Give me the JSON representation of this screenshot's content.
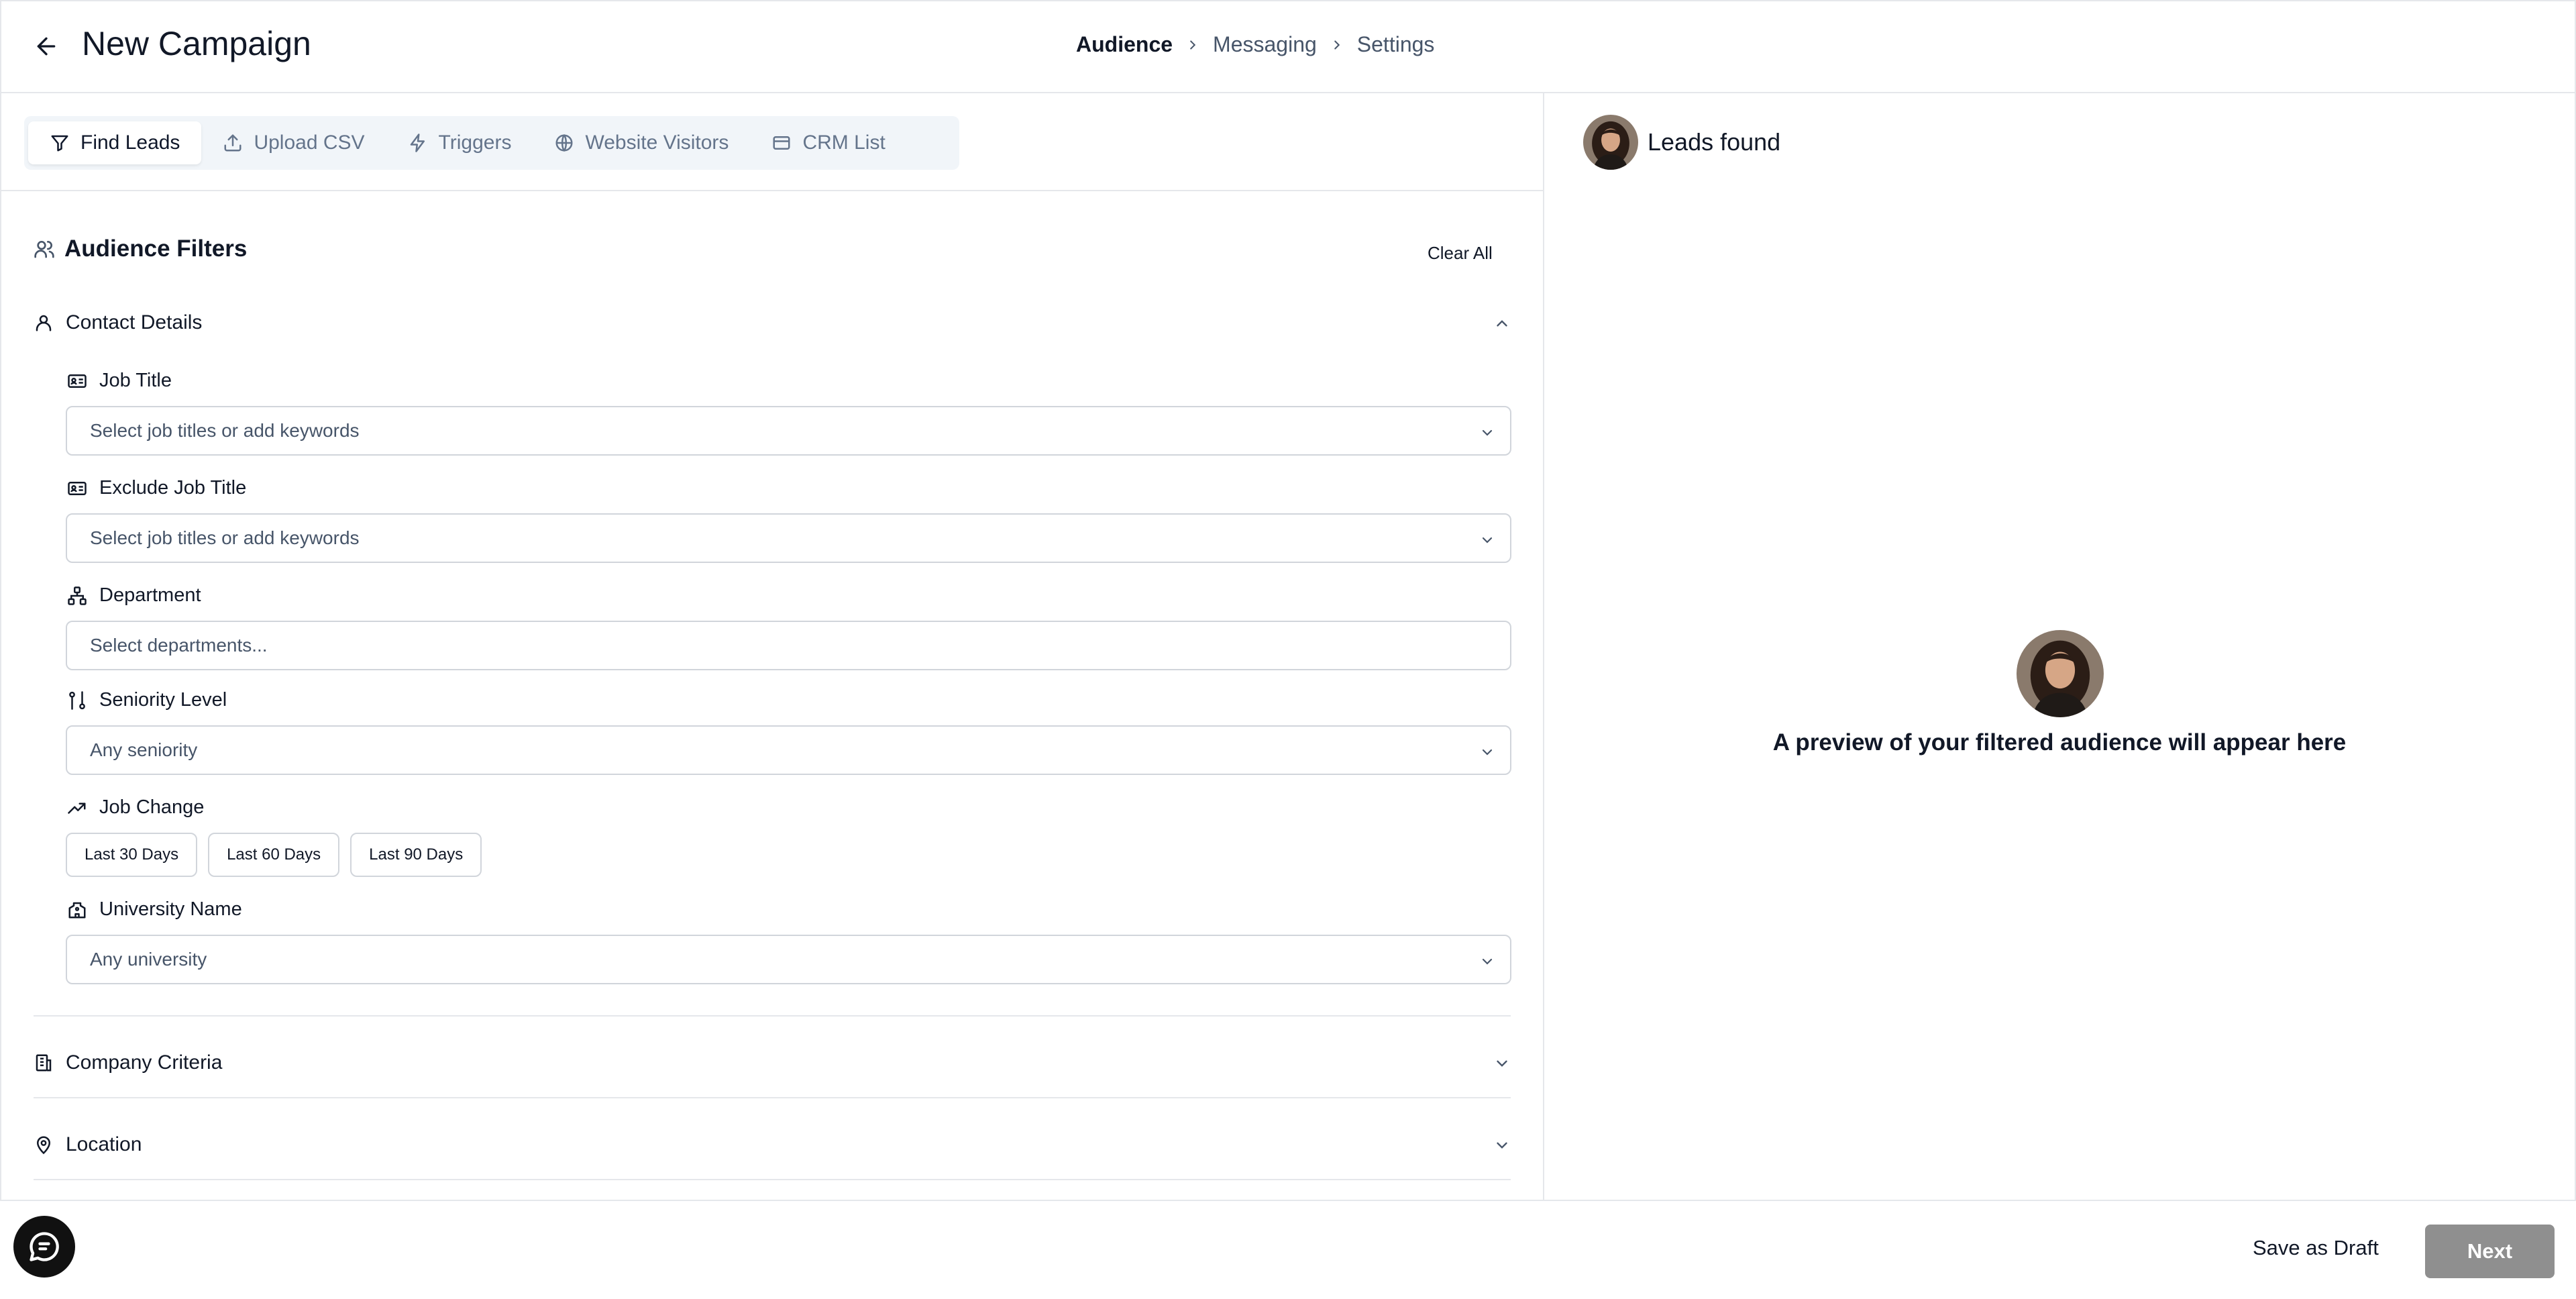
{
  "header": {
    "title": "New Campaign",
    "steps": [
      "Audience",
      "Messaging",
      "Settings"
    ],
    "active_step": "Audience"
  },
  "tabs": [
    {
      "label": "Find Leads",
      "icon": "filter-icon",
      "active": true
    },
    {
      "label": "Upload CSV",
      "icon": "upload-icon",
      "active": false
    },
    {
      "label": "Triggers",
      "icon": "lightning-icon",
      "active": false
    },
    {
      "label": "Website Visitors",
      "icon": "globe-icon",
      "active": false
    },
    {
      "label": "CRM List",
      "icon": "card-icon",
      "active": false
    }
  ],
  "filters": {
    "title": "Audience Filters",
    "clear_all": "Clear All",
    "contact_details": {
      "label": "Contact Details",
      "job_title": {
        "label": "Job Title",
        "placeholder": "Select job titles or add keywords"
      },
      "exclude_job_title": {
        "label": "Exclude Job Title",
        "placeholder": "Select job titles or add keywords"
      },
      "department": {
        "label": "Department",
        "placeholder": "Select departments..."
      },
      "seniority": {
        "label": "Seniority Level",
        "value": "Any seniority"
      },
      "job_change": {
        "label": "Job Change",
        "options": [
          "Last 30 Days",
          "Last 60 Days",
          "Last 90 Days"
        ]
      },
      "university": {
        "label": "University Name",
        "value": "Any university"
      }
    },
    "company_criteria": {
      "label": "Company Criteria"
    },
    "location": {
      "label": "Location"
    }
  },
  "preview": {
    "leads_found": "Leads found",
    "empty_text": "A preview of your filtered audience will appear here"
  },
  "footer": {
    "save_draft": "Save as Draft",
    "next": "Next"
  },
  "colors": {
    "border": "#e5e7eb",
    "muted_text": "#475569",
    "next_button_bg": "#8f8f8f",
    "tab_bar_bg": "#f1f5f9"
  }
}
